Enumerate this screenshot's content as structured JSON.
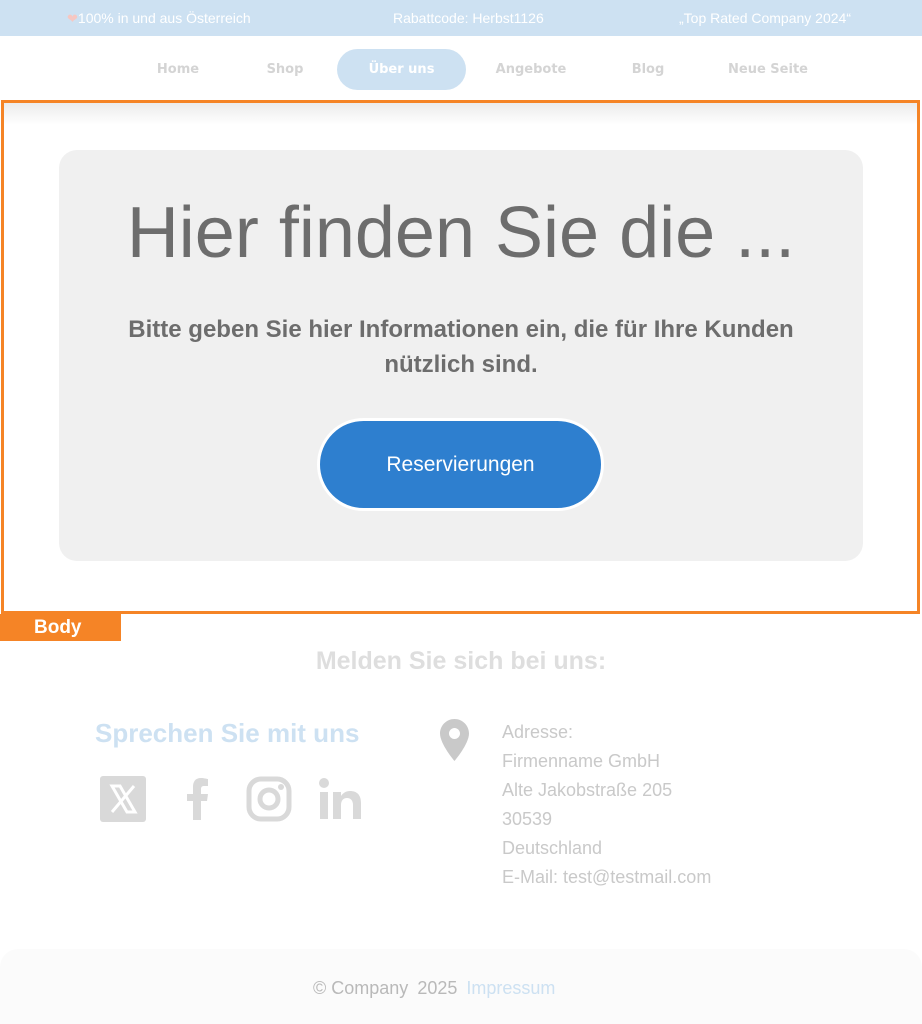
{
  "topbar": {
    "message_austria": "100% in und aus Österreich",
    "discount_code": "Rabattcode: Herbst1126",
    "award": "„Top Rated Company 2024“"
  },
  "nav": {
    "items": [
      {
        "label": "Home"
      },
      {
        "label": "Shop"
      },
      {
        "label": "Über uns",
        "active": true
      },
      {
        "label": "Angebote"
      },
      {
        "label": "Blog"
      },
      {
        "label": "Neue Seite"
      }
    ]
  },
  "section_label": "Body",
  "hero": {
    "title": "Hier finden Sie die ...",
    "subtitle": "Bitte geben Sie hier Informationen ein, die für Ihre Kunden nützlich sind.",
    "button_label": "Reservierungen"
  },
  "contact": {
    "signup_heading": "Melden Sie sich bei uns:",
    "talk_heading": "Sprechen Sie mit uns",
    "social_icons": [
      "x-icon",
      "facebook-icon",
      "instagram-icon",
      "linkedin-icon"
    ],
    "address_lines": [
      "Adresse:",
      "Firmenname GmbH",
      "Alte Jakobstraße 205",
      "30539",
      "Deutschland",
      "E-Mail: test@testmail.com"
    ]
  },
  "footer": {
    "copyright": "© Company",
    "year": "2025",
    "imprint_link": "Impressum"
  },
  "colors": {
    "accent_blue": "#2e7fcf",
    "light_blue": "#cde1f2",
    "highlight_orange": "#f58426"
  }
}
